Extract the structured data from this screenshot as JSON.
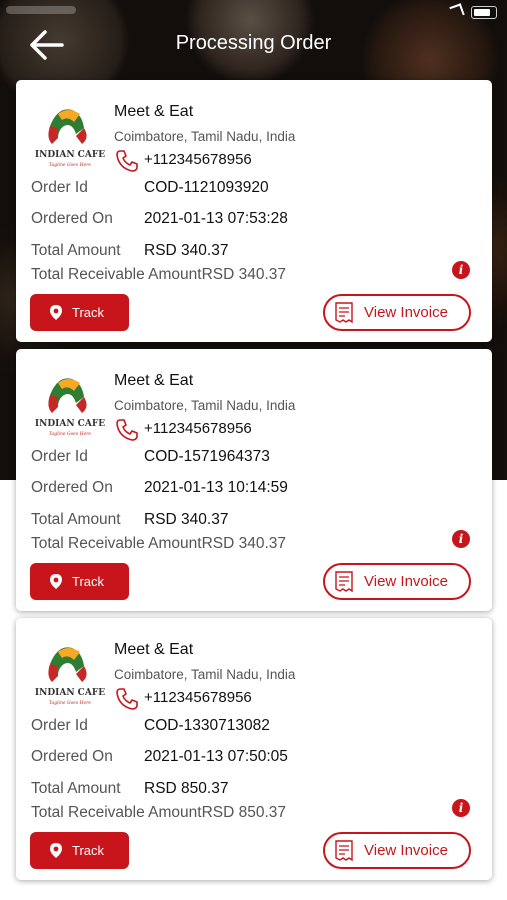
{
  "header": {
    "title": "Processing Order"
  },
  "labels": {
    "order_id": "Order Id",
    "ordered_on": "Ordered On",
    "total_amount": "Total Amount",
    "total_receivable": "Total Receivable Amount",
    "track": "Track",
    "view_invoice": "View Invoice",
    "info": "i"
  },
  "colors": {
    "accent": "#c7151b"
  },
  "orders": [
    {
      "restaurant": "Meet & Eat",
      "location": "Coimbatore, Tamil Nadu, India",
      "phone": "+112345678956",
      "order_id": "COD-1121093920",
      "ordered_on": "2021-01-13 07:53:28",
      "total_amount": "RSD 340.37",
      "receivable": "RSD 340.37"
    },
    {
      "restaurant": "Meet & Eat",
      "location": "Coimbatore, Tamil Nadu, India",
      "phone": "+112345678956",
      "order_id": "COD-1571964373",
      "ordered_on": "2021-01-13 10:14:59",
      "total_amount": "RSD 340.37",
      "receivable": "RSD 340.37"
    },
    {
      "restaurant": "Meet & Eat",
      "location": "Coimbatore, Tamil Nadu, India",
      "phone": "+112345678956",
      "order_id": "COD-1330713082",
      "ordered_on": "2021-01-13 07:50:05",
      "total_amount": "RSD 850.37",
      "receivable": "RSD 850.37"
    }
  ],
  "logo": {
    "name": "INDIAN CAFE",
    "tagline": "Tagline Goes Here"
  }
}
